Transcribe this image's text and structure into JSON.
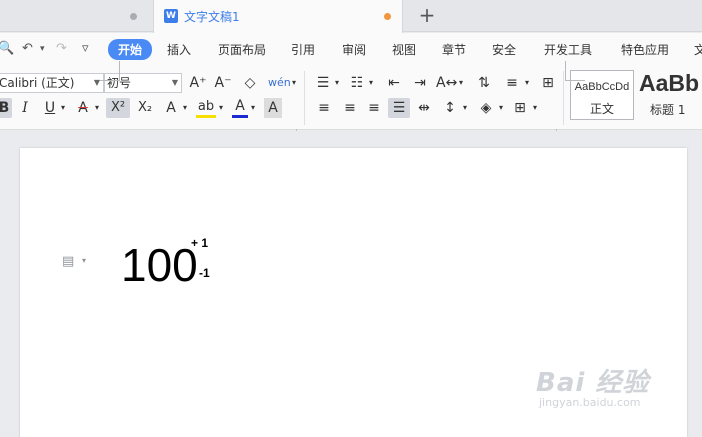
{
  "tabs": {
    "active_title": "文字文稿1",
    "doc_icon_letter": "W",
    "new_tab": "+"
  },
  "menu": {
    "active": "开始",
    "items": [
      "插入",
      "页面布局",
      "引用",
      "审阅",
      "视图",
      "章节",
      "安全",
      "开发工具",
      "特色应用",
      "文"
    ]
  },
  "quick_access": {
    "preview": "🔍",
    "undo": "↶",
    "redo": "↷",
    "more": "▿"
  },
  "font": {
    "family": "Calibri (正文)",
    "size": "初号"
  },
  "format": {
    "grow": "A⁺",
    "shrink": "A⁻",
    "clear": "◇",
    "pinyin": "wén",
    "bold": "B",
    "italic": "I",
    "underline": "U",
    "strike": "A",
    "superscript": "X²",
    "subscript": "X₂",
    "text_effect": "A",
    "highlight": "ab",
    "font_color": "A",
    "char_shading": "A"
  },
  "styles": {
    "normal_sample": "AaBbCcDd",
    "normal_label": "正文",
    "heading_sample": "AaBb",
    "heading_label": "标题 1"
  },
  "document": {
    "main_text": "100",
    "superscript": "+ 1",
    "subscript": "-1"
  },
  "watermark": {
    "line1": "Bai 经验",
    "line2": "jingyan.baidu.com"
  },
  "colors": {
    "accent": "#4a8af4",
    "modified_dot": "#f0963c",
    "font_color_bar": "#1a2bd6",
    "highlight_bar": "#f5e000"
  }
}
